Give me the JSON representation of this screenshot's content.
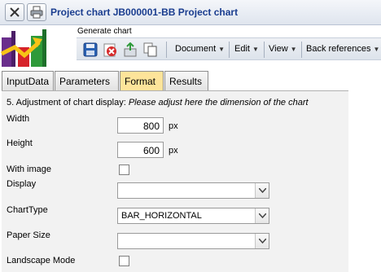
{
  "window": {
    "title": "Project chart JB000001-BB Project chart"
  },
  "icons": {
    "close": "close-icon",
    "print": "printer-icon",
    "logo": "chart-logo-icon",
    "save": "save-icon",
    "delete": "delete-icon",
    "export": "export-icon",
    "copy": "copy-icon"
  },
  "toolbar": {
    "section_label": "Generate chart",
    "menus": {
      "document": "Document",
      "edit": "Edit",
      "view": "View",
      "back_references": "Back references"
    }
  },
  "tabs": {
    "input_data": "InputData",
    "parameters": "Parameters",
    "format": "Format",
    "results": "Results",
    "active": "Format"
  },
  "form": {
    "heading_prefix": "5. Adjustment of chart display: ",
    "heading_note": "Please adjust here the dimension of the chart",
    "width": {
      "label": "Width",
      "value": "800",
      "unit": "px"
    },
    "height": {
      "label": "Height",
      "value": "600",
      "unit": "px"
    },
    "with_image": {
      "label": "With image",
      "checked": false
    },
    "display": {
      "label": "Display",
      "value": ""
    },
    "chart_type": {
      "label": "ChartType",
      "value": "BAR_HORIZONTAL"
    },
    "paper_size": {
      "label": "Paper Size",
      "value": ""
    },
    "landscape_mode": {
      "label": "Landscape Mode",
      "checked": false
    }
  },
  "colors": {
    "title_text": "#1a3d8f",
    "active_tab": "#fde49a",
    "panel_bg": "#f2f2f2"
  }
}
